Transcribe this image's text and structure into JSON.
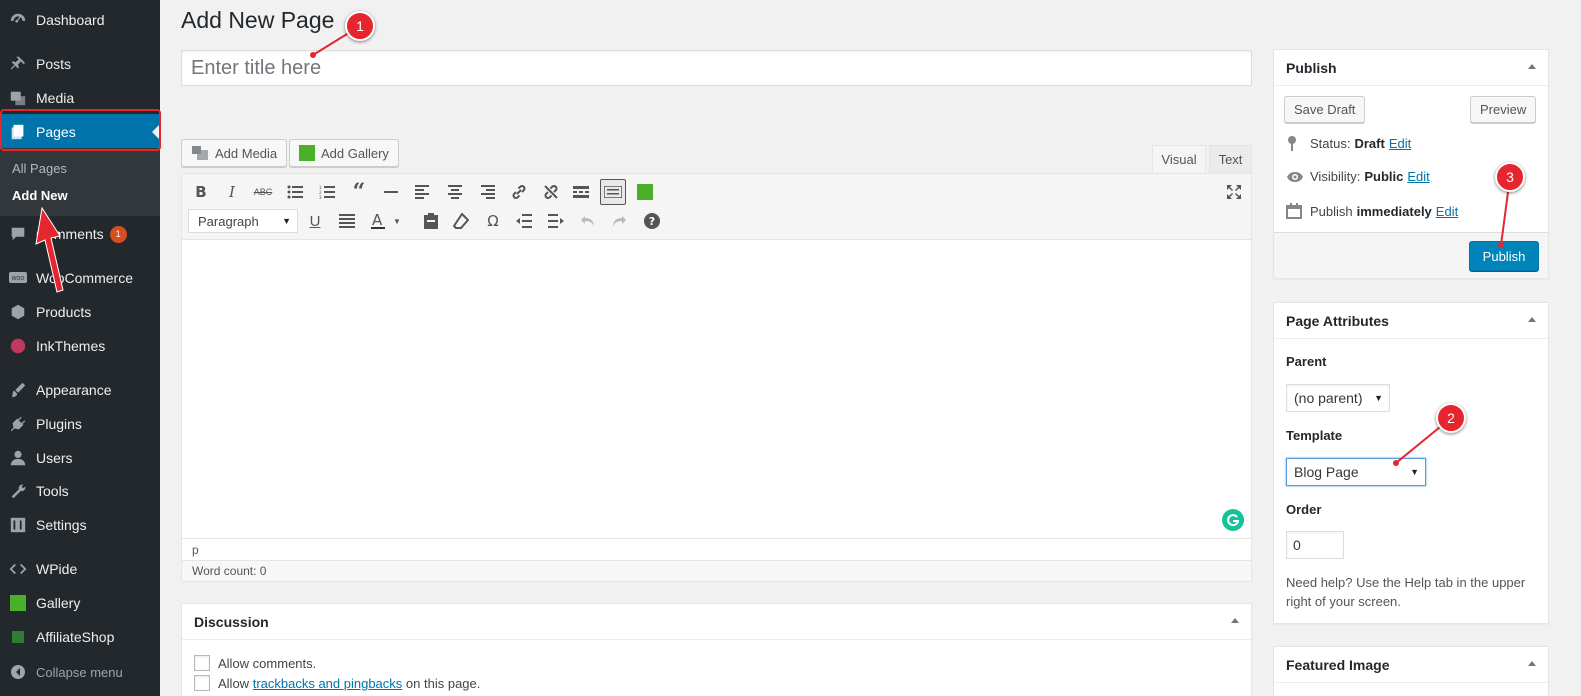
{
  "sidebar": {
    "items": [
      {
        "label": "Dashboard",
        "icon": "dashboard-icon"
      },
      {
        "label": "Posts",
        "icon": "pin-icon"
      },
      {
        "label": "Media",
        "icon": "media-icon"
      },
      {
        "label": "Pages",
        "icon": "pages-icon"
      },
      {
        "label": "Comments",
        "icon": "comment-icon",
        "badge": "1"
      },
      {
        "label": "WooCommerce",
        "icon": "woo-icon"
      },
      {
        "label": "Products",
        "icon": "box-icon"
      },
      {
        "label": "InkThemes",
        "icon": "inkthemes-icon"
      },
      {
        "label": "Appearance",
        "icon": "brush-icon"
      },
      {
        "label": "Plugins",
        "icon": "plug-icon"
      },
      {
        "label": "Users",
        "icon": "user-icon"
      },
      {
        "label": "Tools",
        "icon": "wrench-icon"
      },
      {
        "label": "Settings",
        "icon": "settings-icon"
      },
      {
        "label": "WPide",
        "icon": "code-icon"
      },
      {
        "label": "Gallery",
        "icon": "gallery-icon"
      },
      {
        "label": "AffiliateShop",
        "icon": "shop-icon"
      }
    ],
    "submenu": {
      "all_pages": "All Pages",
      "add_new": "Add New"
    },
    "collapse": "Collapse menu",
    "active_color": "#0073aa"
  },
  "main": {
    "page_title": "Add New Page",
    "title_placeholder": "Enter title here",
    "add_media": "Add Media",
    "add_gallery": "Add Gallery",
    "tab_visual": "Visual",
    "tab_text": "Text",
    "format_value": "Paragraph",
    "path": "p",
    "word_count": "Word count: 0"
  },
  "publish": {
    "title": "Publish",
    "save_draft": "Save Draft",
    "preview": "Preview",
    "status_label": "Status:",
    "status_value": "Draft",
    "visibility_label": "Visibility:",
    "visibility_value": "Public",
    "schedule_label": "Publish",
    "schedule_value": "immediately",
    "edit": "Edit",
    "publish_button": "Publish",
    "button_color": "#0085ba"
  },
  "attributes": {
    "title": "Page Attributes",
    "parent_label": "Parent",
    "parent_value": "(no parent)",
    "template_label": "Template",
    "template_value": "Blog Page",
    "order_label": "Order",
    "order_value": "0",
    "help": "Need help? Use the Help tab in the upper right of your screen."
  },
  "featured": {
    "title": "Featured Image"
  },
  "discussion": {
    "title": "Discussion",
    "allow_comments": "Allow comments.",
    "allow_prefix": "Allow",
    "trackbacks_link": "trackbacks and pingbacks",
    "allow_suffix": "on this page."
  },
  "annotations": {
    "one": "1",
    "two": "2",
    "three": "3",
    "color": "#e5262f"
  }
}
